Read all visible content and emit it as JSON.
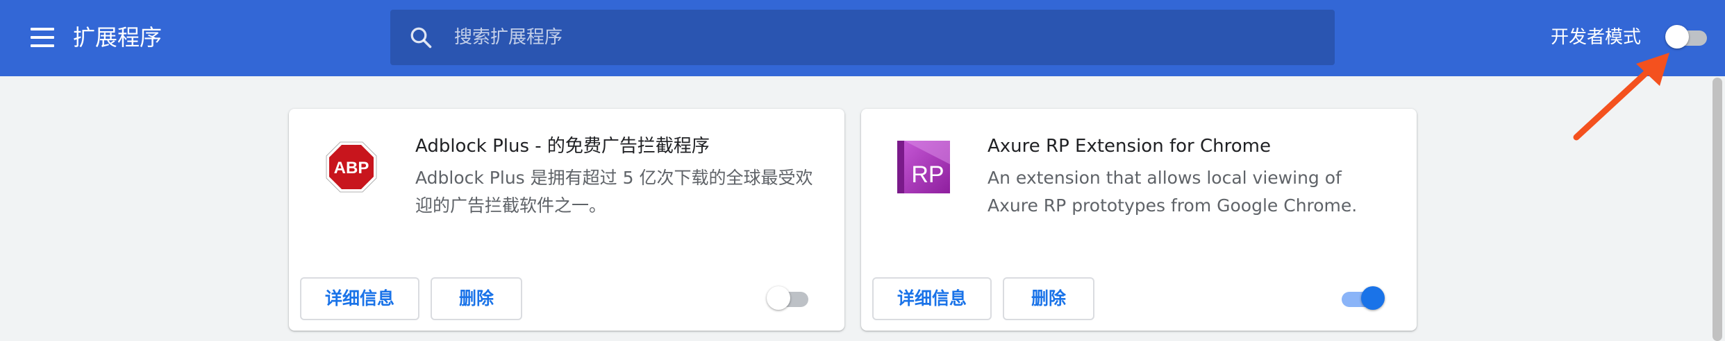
{
  "header": {
    "title": "扩展程序",
    "search_placeholder": "搜索扩展程序",
    "developer_mode_label": "开发者模式",
    "developer_mode_on": false
  },
  "extensions": [
    {
      "name": "Adblock Plus - 的免费广告拦截程序",
      "description": "Adblock Plus 是拥有超过 5 亿次下载的全球最受欢迎的广告拦截软件之一。",
      "icon": "abp-stop-sign-icon",
      "icon_text": "ABP",
      "details_label": "详细信息",
      "remove_label": "删除",
      "enabled": false
    },
    {
      "name": "Axure RP Extension for Chrome",
      "description": "An extension that allows local viewing of Axure RP prototypes from Google Chrome.",
      "icon": "axure-rp-icon",
      "icon_text": "RP",
      "details_label": "详细信息",
      "remove_label": "删除",
      "enabled": true
    }
  ],
  "colors": {
    "header_bg": "#3367d6",
    "search_bg": "#2a55b1",
    "page_bg": "#f1f3f4",
    "accent": "#1a73e8",
    "annotation_arrow": "#f4511e"
  }
}
